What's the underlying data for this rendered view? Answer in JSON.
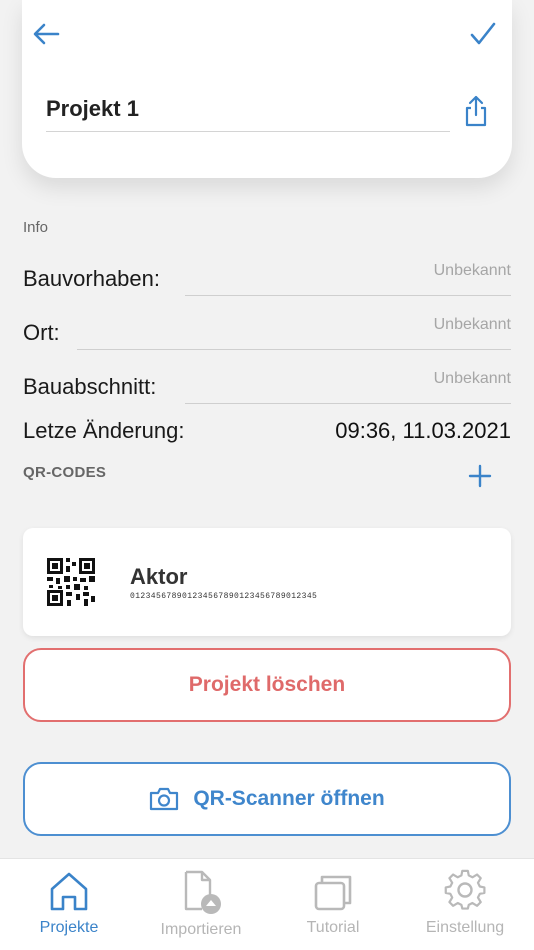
{
  "header": {
    "title_value": "Projekt 1"
  },
  "info": {
    "section_label": "Info",
    "fields": [
      {
        "label": "Bauvorhaben:",
        "placeholder": "Unbekannt"
      },
      {
        "label": "Ort:",
        "placeholder": "Unbekannt"
      },
      {
        "label": "Bauabschnitt:",
        "placeholder": "Unbekannt"
      }
    ],
    "last_change_label": "Letze Änderung:",
    "last_change_value": "09:36, 11.03.2021"
  },
  "qr_codes": {
    "section_label": "QR-CODES",
    "items": [
      {
        "name": "Aktor",
        "code": "01234567890123456789012345678901234​5"
      }
    ]
  },
  "actions": {
    "delete_label": "Projekt löschen",
    "scan_label": "QR-Scanner öffnen"
  },
  "tabbar": {
    "tabs": [
      {
        "label": "Projekte",
        "icon": "home-icon",
        "active": true
      },
      {
        "label": "Importieren",
        "icon": "import-file-icon",
        "active": false
      },
      {
        "label": "Tutorial",
        "icon": "tutorial-icon",
        "active": false
      },
      {
        "label": "Einstellung",
        "icon": "gear-icon",
        "active": false
      }
    ]
  },
  "colors": {
    "accent_blue": "#3a83c9",
    "danger_red": "#df6a6a",
    "background": "#f2f2f2"
  }
}
